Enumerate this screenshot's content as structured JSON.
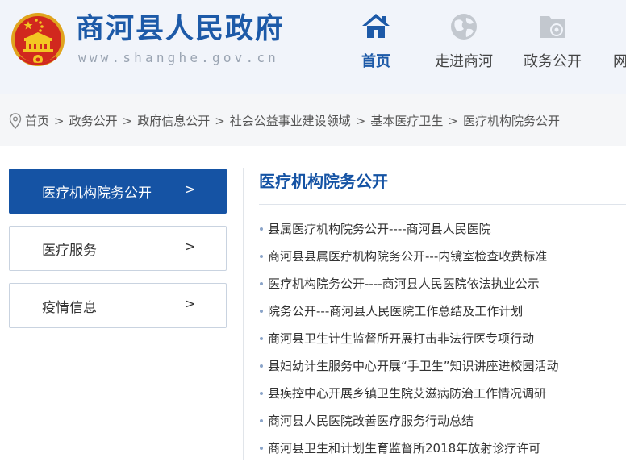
{
  "header": {
    "title": "商河县人民政府",
    "domain": "www.shanghe.gov.cn",
    "emblem_icon": "national-emblem-icon",
    "nav": [
      {
        "label": "首页",
        "icon": "home-icon",
        "active": true
      },
      {
        "label": "走进商河",
        "icon": "globe-icon",
        "active": false
      },
      {
        "label": "政务公开",
        "icon": "folder-gear-icon",
        "active": false
      },
      {
        "label": "网",
        "icon": "",
        "active": false
      }
    ]
  },
  "breadcrumb": {
    "icon": "location-pin-icon",
    "items": [
      "首页",
      "政务公开",
      "政府信息公开",
      "社会公益事业建设领域",
      "基本医疗卫生",
      "医疗机构院务公开"
    ],
    "separator": ">"
  },
  "sidebar": {
    "items": [
      {
        "label": "医疗机构院务公开",
        "arrow": ">",
        "active": true
      },
      {
        "label": "医疗服务",
        "arrow": ">",
        "active": false
      },
      {
        "label": "疫情信息",
        "arrow": ">",
        "active": false
      }
    ]
  },
  "main": {
    "title": "医疗机构院务公开",
    "items": [
      "县属医疗机构院务公开----商河县人民医院",
      "商河县县属医疗机构院务公开---内镜室检查收费标准",
      "医疗机构院务公开----商河县人民医院依法执业公示",
      "院务公开---商河县人民医院工作总结及工作计划",
      "商河县卫生计生监督所开展打击非法行医专项行动",
      "县妇幼计生服务中心开展“手卫生”知识讲座进校园活动",
      "县疾控中心开展乡镇卫生院艾滋病防治工作情况调研",
      "商河县人民医院改善医疗服务行动总结",
      "商河县卫生和计划生育监督所2018年放射诊疗许可"
    ]
  },
  "colors": {
    "brand_blue": "#1553a4",
    "title_blue": "#1d5aa8",
    "header_bg": "#f1f4fa",
    "breadcrumb_bg": "#f5f6f8"
  }
}
